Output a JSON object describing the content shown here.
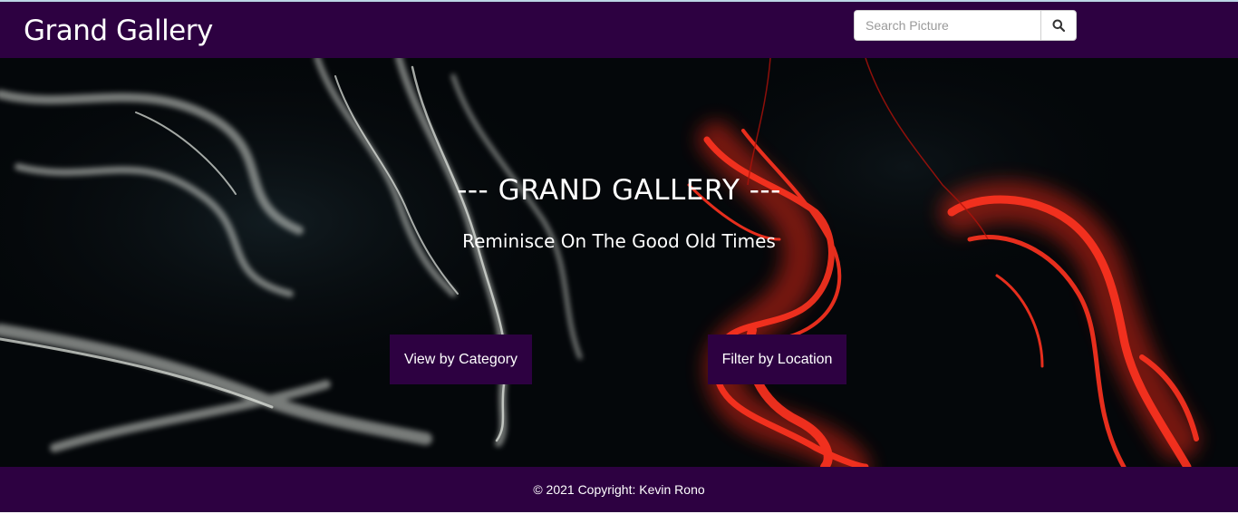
{
  "navbar": {
    "brand": "Grand Gallery",
    "search": {
      "placeholder": "Search Picture",
      "value": "",
      "button_icon": "search-icon"
    }
  },
  "hero": {
    "title": "--- GRAND GALLERY ---",
    "subtitle": "Reminisce On The Good Old Times",
    "buttons": {
      "category": "View by Category",
      "location": "Filter by Location"
    }
  },
  "footer": {
    "copyright": "© 2021 Copyright: Kevin Rono"
  },
  "colors": {
    "primary": "#2d0141",
    "hero_bg": "#05080a",
    "smoke_red": "#ff2a14",
    "smoke_white": "#d8dcd6"
  }
}
